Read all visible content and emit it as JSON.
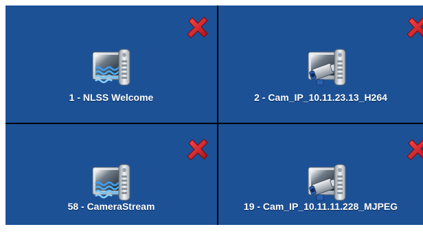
{
  "colors": {
    "tile_background": "#1c5196",
    "divider": "#000000",
    "close_icon": "#c8141e",
    "label_text": "#ffffff"
  },
  "tiles": [
    {
      "label": "1 - NLSS Welcome",
      "icon": "video-wave-icon",
      "close_icon": "close-icon"
    },
    {
      "label": "2 - Cam_IP_10.11.23.13_H264",
      "icon": "ip-camera-icon",
      "close_icon": "close-icon"
    },
    {
      "label": "58 - CameraStream",
      "icon": "video-wave-icon",
      "close_icon": "close-icon"
    },
    {
      "label": "19 - Cam_IP_10.11.11.228_MJPEG",
      "icon": "ip-camera-icon",
      "close_icon": "close-icon"
    }
  ]
}
